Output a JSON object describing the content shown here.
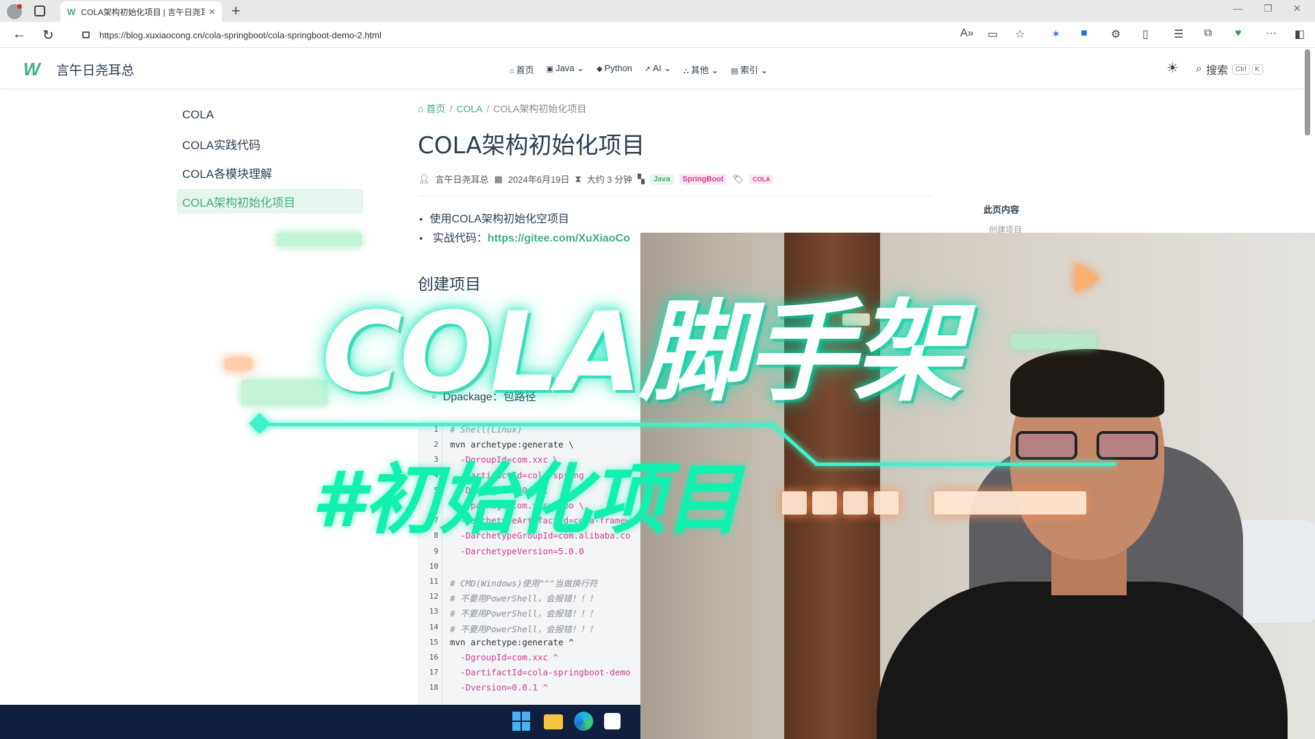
{
  "browser": {
    "tab_title": "COLA架构初始化项目 | 言午日尧耳总",
    "tab_favicon": "W",
    "url": "https://blog.xuxiaocong.cn/cola-springboot/cola-springboot-demo-2.html"
  },
  "site": {
    "name": "言午日尧耳总",
    "menu": [
      {
        "icon": "home-icon",
        "label": "首页"
      },
      {
        "icon": "java-icon",
        "label": "Java"
      },
      {
        "icon": "python-icon",
        "label": "Python"
      },
      {
        "icon": "rocket-icon",
        "label": "AI"
      },
      {
        "icon": "sitemap-icon",
        "label": "其他"
      },
      {
        "icon": "book-icon",
        "label": "索引"
      }
    ],
    "search_label": "搜索",
    "search_kbd_1": "Ctrl",
    "search_kbd_2": "K"
  },
  "sidebar": {
    "items": [
      "COLA",
      "COLA实践代码",
      "COLA各模块理解",
      "COLA架构初始化项目"
    ]
  },
  "article": {
    "breadcrumb": {
      "home": "首页",
      "section": "COLA",
      "current": "COLA架构初始化项目"
    },
    "title": "COLA架构初始化项目",
    "author": "言午日尧耳总",
    "date": "2024年6月19日",
    "read_time": "大约 3 分钟",
    "categories": [
      "Java",
      "SpringBoot"
    ],
    "tag": "COLA",
    "bullet_1": "使用COLA架构初始化空项目",
    "bullet_2_label": "实战代码：",
    "bullet_2_link": "https://gitee.com/XuXiaoCo",
    "section_heading": "创建项目",
    "package_item": "Dpackage：包路径"
  },
  "toc": {
    "heading": "此页内容",
    "item": "创建项目"
  },
  "code": {
    "lines": [
      {
        "n": "1",
        "text": "# Shell(Linux)",
        "kind": "c"
      },
      {
        "n": "2",
        "text": "mvn archetype:generate \\",
        "kind": "n"
      },
      {
        "n": "3",
        "text": "  -DgroupId=com.xxc \\",
        "kind": "p"
      },
      {
        "n": "4",
        "text": "  -DartifactId=cola-spring",
        "kind": "p"
      },
      {
        "n": "5",
        "text": "  -Dversion=0.0.1 \\",
        "kind": "p"
      },
      {
        "n": "6",
        "text": "  -Dpackage=com.xxc.demo \\",
        "kind": "p"
      },
      {
        "n": "7",
        "text": "  -DarchetypeArtifactId=cola-framew",
        "kind": "p"
      },
      {
        "n": "8",
        "text": "  -DarchetypeGroupId=com.alibaba.co",
        "kind": "p"
      },
      {
        "n": "9",
        "text": "  -DarchetypeVersion=5.0.0",
        "kind": "p"
      },
      {
        "n": "10",
        "text": "",
        "kind": "n"
      },
      {
        "n": "11",
        "text": "# CMD(Windows)使用\"^\"当做换行符",
        "kind": "c"
      },
      {
        "n": "12",
        "text": "# 不要用PowerShell，会报错！！！",
        "kind": "c"
      },
      {
        "n": "13",
        "text": "# 不要用PowerShell，会报错！！！",
        "kind": "c"
      },
      {
        "n": "14",
        "text": "# 不要用PowerShell，会报错！！！",
        "kind": "c"
      },
      {
        "n": "15",
        "text": "mvn archetype:generate ^",
        "kind": "n"
      },
      {
        "n": "16",
        "text": "  -DgroupId=com.xxc ^",
        "kind": "p"
      },
      {
        "n": "17",
        "text": "  -DartifactId=cola-springboot-demo",
        "kind": "p"
      },
      {
        "n": "18",
        "text": "  -Dversion=0.0.1 ^",
        "kind": "p"
      }
    ]
  },
  "overlay": {
    "title": "COLA脚手架",
    "subtitle": "#初始化项目"
  },
  "colors": {
    "accent": "#3eaf7c",
    "neon": "#3ff2c9",
    "subtitle": "#12f0b0"
  }
}
